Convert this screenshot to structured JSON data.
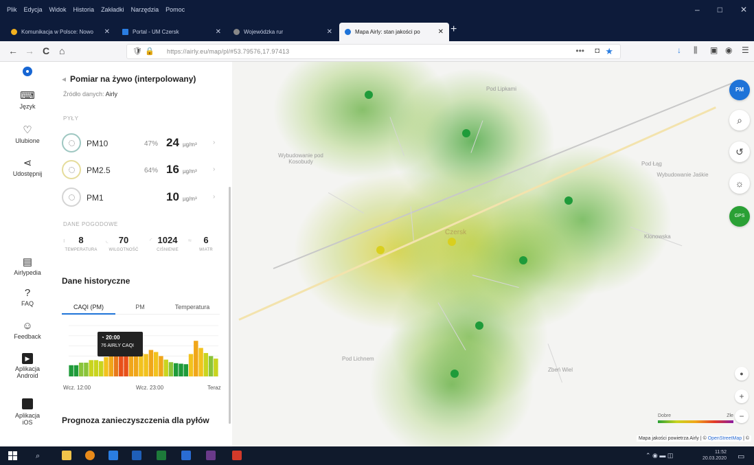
{
  "browser": {
    "menus": [
      "Plik",
      "Edycja",
      "Widok",
      "Historia",
      "Zakładki",
      "Narzędzia",
      "Pomoc"
    ],
    "window_controls": [
      "–",
      "□",
      "✕"
    ],
    "tabs": [
      {
        "label": "Komunikacja w Polsce: Nowo",
        "favicon_color": "#f2b01e",
        "active": false
      },
      {
        "label": "Portal - UM Czersk",
        "favicon_color": "#2a7de1",
        "active": false
      },
      {
        "label": "Wojewódzka rur",
        "favicon_color": "#888888",
        "active": false
      },
      {
        "label": "Mapa Airly: stan jakości po",
        "favicon_color": "#1e73d8",
        "active": true
      }
    ],
    "new_tab_symbol": "+",
    "url": "https://airly.eu/map/pl/#53.79576,17.97413",
    "nav": {
      "back": "←",
      "forward": "→",
      "reload": "C",
      "home": "⌂"
    },
    "url_icons": {
      "shield": "🛡",
      "lock": "🔒",
      "more": "•••",
      "pocket": "◘",
      "star": "★"
    },
    "toolbar_icons": [
      "↓",
      "⫼",
      "▣",
      "◉",
      "☰"
    ]
  },
  "leftnav": {
    "items": [
      {
        "label": "Język",
        "icon": "language-icon",
        "glyph": "⌨"
      },
      {
        "label": "Ulubione",
        "icon": "heart-icon",
        "glyph": "♡"
      },
      {
        "label": "Udostępnij",
        "icon": "share-icon",
        "glyph": "⋖"
      },
      {
        "label": "Airlypedia",
        "icon": "book-icon",
        "glyph": "▤"
      },
      {
        "label": "FAQ",
        "icon": "faq-icon",
        "glyph": "?"
      },
      {
        "label": "Feedback",
        "icon": "feedback-icon",
        "glyph": "☺"
      },
      {
        "label": "Aplikacja Android",
        "icon": "android-play-icon",
        "glyph": "▶"
      },
      {
        "label": "Aplikacja iOS",
        "icon": "apple-icon",
        "glyph": ""
      }
    ]
  },
  "panel": {
    "title": "Pomiar na żywo (interpolowany)",
    "source_label": "Źródło danych:",
    "source_value": "Airly",
    "pm_section": "PYŁY",
    "pm": [
      {
        "name": "PM10",
        "pct": "47%",
        "value": "24",
        "unit": "µg/m³"
      },
      {
        "name": "PM2.5",
        "pct": "64%",
        "value": "16",
        "unit": "µg/m³"
      },
      {
        "name": "PM1",
        "pct": "",
        "value": "10",
        "unit": "µg/m³"
      }
    ],
    "weather_section": "DANE POGODOWE",
    "weather": [
      {
        "value": "8",
        "label": "TEMPERATURA"
      },
      {
        "value": "70",
        "label": "WILGOTNOŚĆ"
      },
      {
        "value": "1024",
        "label": "CIŚNIENIE"
      },
      {
        "value": "6",
        "label": "WIATR"
      }
    ],
    "history_title": "Dane historyczne",
    "history_tabs": [
      "CAQI (PM)",
      "PM",
      "Temperatura"
    ],
    "tooltip": {
      "time": "20:00",
      "text": "76 AIRLY CAQI"
    },
    "chart_x_labels": [
      "Wcz. 12:00",
      "Wcz. 23:00",
      "Teraz"
    ],
    "forecast_title": "Prognoza zanieczyszczenia dla pyłów"
  },
  "chart_data": {
    "type": "bar",
    "ylim": [
      0,
      100
    ],
    "colors": [
      "#1f9b3a",
      "#1f9b3a",
      "#8ac43a",
      "#8ac43a",
      "#c9d41e",
      "#c9d41e",
      "#c9d41e",
      "#f2c21e",
      "#f0a61a",
      "#e8791a",
      "#e8501a",
      "#e8501a",
      "#f0a61a",
      "#f0a61a",
      "#f2c21e",
      "#f2c21e",
      "#f0a61a",
      "#f2c21e",
      "#f0a61a",
      "#c9d41e",
      "#8ac43a",
      "#1f9b3a",
      "#1f9b3a",
      "#1f9b3a",
      "#f2c21e",
      "#f0a61a",
      "#f2c21e",
      "#c9d41e",
      "#8ac43a",
      "#c9d41e"
    ],
    "values": [
      22,
      22,
      27,
      27,
      32,
      32,
      30,
      38,
      42,
      76,
      68,
      74,
      60,
      50,
      46,
      44,
      52,
      48,
      40,
      33,
      28,
      26,
      25,
      24,
      44,
      70,
      56,
      46,
      40,
      35
    ]
  },
  "map": {
    "places": [
      {
        "name": "Pod Lipkami",
        "cls": ""
      },
      {
        "name": "Wybudowanie pod Kosobudy",
        "cls": ""
      },
      {
        "name": "Pod Łąg",
        "cls": ""
      },
      {
        "name": "Wybudowanie Jaśkie",
        "cls": ""
      },
      {
        "name": "Czersk",
        "cls": "big"
      },
      {
        "name": "Klonowska",
        "cls": ""
      },
      {
        "name": "Pod Lichnem",
        "cls": ""
      },
      {
        "name": "Zbeń Wiel",
        "cls": ""
      }
    ],
    "buttons": {
      "pm": "PM",
      "search": "⌕",
      "history": "↺",
      "wind": "☼",
      "locate": "GPS"
    },
    "legend": {
      "low": "Dobre",
      "high": "Złe"
    },
    "attribution": "Mapa jakości powietrza Airly | ©",
    "attribution_link": "OpenStreetMap",
    "attribution_tail": "| ©"
  },
  "taskbar": {
    "time": "11:52",
    "date": "20.03.2020",
    "app_colors": [
      "#f0c34a",
      "#e88a1a",
      "#2a7de1",
      "#1f5fb8",
      "#1d7a3a",
      "#2a6cd4",
      "#6a3a8a",
      "#d23a2a"
    ]
  }
}
